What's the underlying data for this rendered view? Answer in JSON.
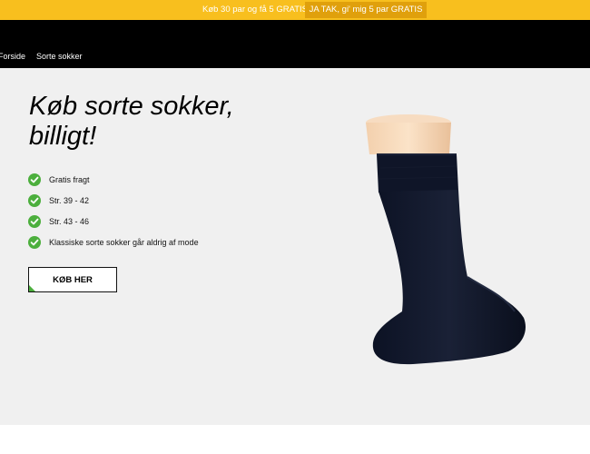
{
  "promo": {
    "text": "Køb 30 par og få 5 GRATIS!",
    "button_label": "JA TAK, gi' mig 5 par GRATIS"
  },
  "nav": {
    "items": [
      {
        "label": "Forside"
      },
      {
        "label": "Sorte sokker"
      }
    ]
  },
  "hero": {
    "title": "Køb sorte sokker, billigt!",
    "features": [
      {
        "label": "Gratis fragt",
        "icon": "check-icon"
      },
      {
        "label": "Str. 39 - 42",
        "icon": "check-icon"
      },
      {
        "label": "Str. 43 - 46",
        "icon": "check-icon"
      },
      {
        "label": "Klassiske sorte sokker går aldrig af mode",
        "icon": "check-icon"
      }
    ],
    "cta_label": "KØB HER",
    "image_icon": "black-sock-image"
  },
  "colors": {
    "promo_bg": "#f8bf1e",
    "promo_button_bg": "#e0a00c",
    "nav_bg": "#000000",
    "accent_green": "#4caf3d",
    "hero_bg": "#f0f0f0"
  }
}
